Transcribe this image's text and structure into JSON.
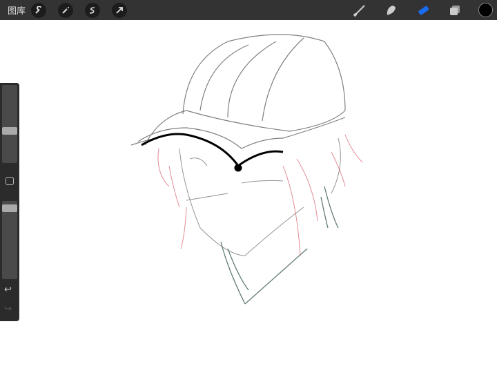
{
  "topbar": {
    "gallery_label": "图库",
    "left_tools": [
      "wrench-icon",
      "magic-wand-icon",
      "selection-icon",
      "transform-arrow-icon"
    ],
    "right_tools": [
      "brush-icon",
      "smudge-icon",
      "eraser-icon",
      "layers-icon"
    ],
    "active_tool": "eraser",
    "accent_color": "#1a6cf0",
    "current_color": "#000000"
  },
  "sidebar": {
    "brush_size": 0.4,
    "opacity": 0.95,
    "undo_icon": "undo-icon",
    "redo_icon": "redo-icon"
  }
}
